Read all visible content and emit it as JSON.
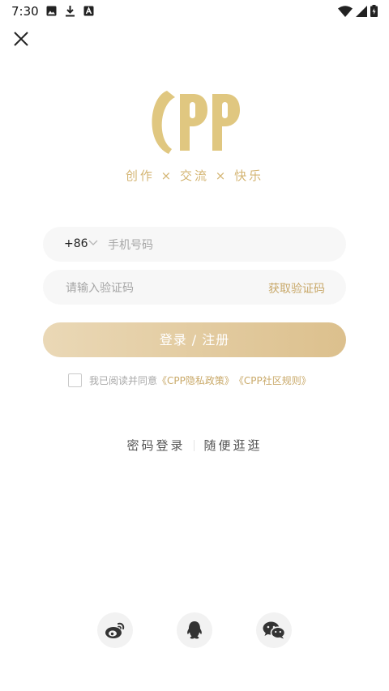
{
  "status_bar": {
    "time": "7:30",
    "left_icons": [
      "image-icon",
      "download-icon",
      "font-icon"
    ],
    "right_icons": [
      "wifi-icon",
      "signal-icon",
      "battery-icon"
    ]
  },
  "icons": {
    "close": "close-icon",
    "chevron": "chevron-down-icon",
    "weibo": "weibo-icon",
    "qq": "qq-icon",
    "wechat": "wechat-icon"
  },
  "logo": {
    "alt": "CPP"
  },
  "slogan": "创作 × 交流 × 快乐",
  "phone": {
    "country_code": "+86",
    "placeholder": "手机号码",
    "value": ""
  },
  "code": {
    "placeholder": "请输入验证码",
    "value": "",
    "get_code_label": "获取验证码"
  },
  "login_button": "登录 / 注册",
  "agreement": {
    "checked": false,
    "prefix": "我已阅读并同意",
    "privacy_link": "《CPP隐私政策》",
    "rules_link": "《CPP社区规则》"
  },
  "alt_login": {
    "password_login": "密码登录",
    "browse": "随便逛逛"
  },
  "colors": {
    "accent": "#c9a969",
    "button_start": "#ead8b6",
    "button_end": "#dcc08d",
    "logo": "#e0c780",
    "field_bg": "#f7f7f7"
  }
}
